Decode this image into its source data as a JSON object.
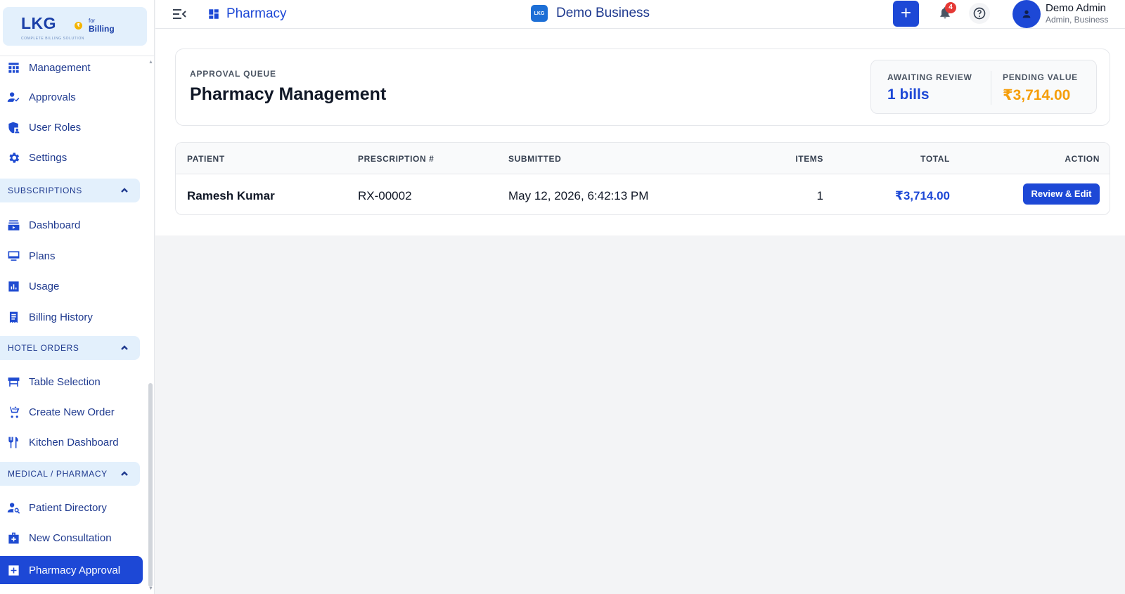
{
  "brand": {
    "logo_text": "LKG",
    "logo_for": "for",
    "logo_billing": "Billing",
    "logo_tagline": "COMPLETE BILLING SOLUTION",
    "coin_symbol": "₹"
  },
  "sidebar": {
    "top_items": [
      {
        "label": "Management",
        "icon": "grid-icon"
      },
      {
        "label": "Approvals",
        "icon": "user-check-icon"
      },
      {
        "label": "User Roles",
        "icon": "shield-user-icon"
      },
      {
        "label": "Settings",
        "icon": "gear-icon"
      }
    ],
    "sections": [
      {
        "title": "SUBSCRIPTIONS",
        "items": [
          {
            "label": "Dashboard",
            "icon": "dashboard-icon"
          },
          {
            "label": "Plans",
            "icon": "plans-icon"
          },
          {
            "label": "Usage",
            "icon": "bar-chart-icon"
          },
          {
            "label": "Billing History",
            "icon": "receipt-icon"
          }
        ]
      },
      {
        "title": "HOTEL ORDERS",
        "items": [
          {
            "label": "Table Selection",
            "icon": "table-icon"
          },
          {
            "label": "Create New Order",
            "icon": "cart-plus-icon"
          },
          {
            "label": "Kitchen Dashboard",
            "icon": "utensils-icon"
          }
        ]
      },
      {
        "title": "MEDICAL / PHARMACY",
        "items": [
          {
            "label": "Patient Directory",
            "icon": "user-search-icon"
          },
          {
            "label": "New Consultation",
            "icon": "medical-bag-icon"
          },
          {
            "label": "Pharmacy Approval",
            "icon": "medical-plus-icon",
            "active": true
          }
        ]
      }
    ]
  },
  "header": {
    "breadcrumb": "Pharmacy",
    "business_logo": "LKG",
    "business_name": "Demo Business",
    "add_symbol": "+",
    "notification_count": "4",
    "user_name": "Demo Admin",
    "user_role": "Admin, Business"
  },
  "summary": {
    "queue_label": "APPROVAL QUEUE",
    "title": "Pharmacy Management",
    "awaiting_label": "AWAITING REVIEW",
    "awaiting_value": "1 bills",
    "pending_label": "PENDING VALUE",
    "pending_value": "₹3,714.00"
  },
  "table": {
    "columns": [
      "PATIENT",
      "PRESCRIPTION #",
      "SUBMITTED",
      "ITEMS",
      "TOTAL",
      "ACTION"
    ],
    "rows": [
      {
        "patient": "Ramesh Kumar",
        "prescription": "RX-00002",
        "submitted": "May 12, 2026, 6:42:13 PM",
        "items": "1",
        "total": "₹3,714.00",
        "action_label": "Review & Edit"
      }
    ]
  },
  "colors": {
    "primary": "#1d48d6",
    "accent_orange": "#f59e0b",
    "sidebar_section_bg": "#e3f0fc",
    "badge_red": "#e53935"
  }
}
